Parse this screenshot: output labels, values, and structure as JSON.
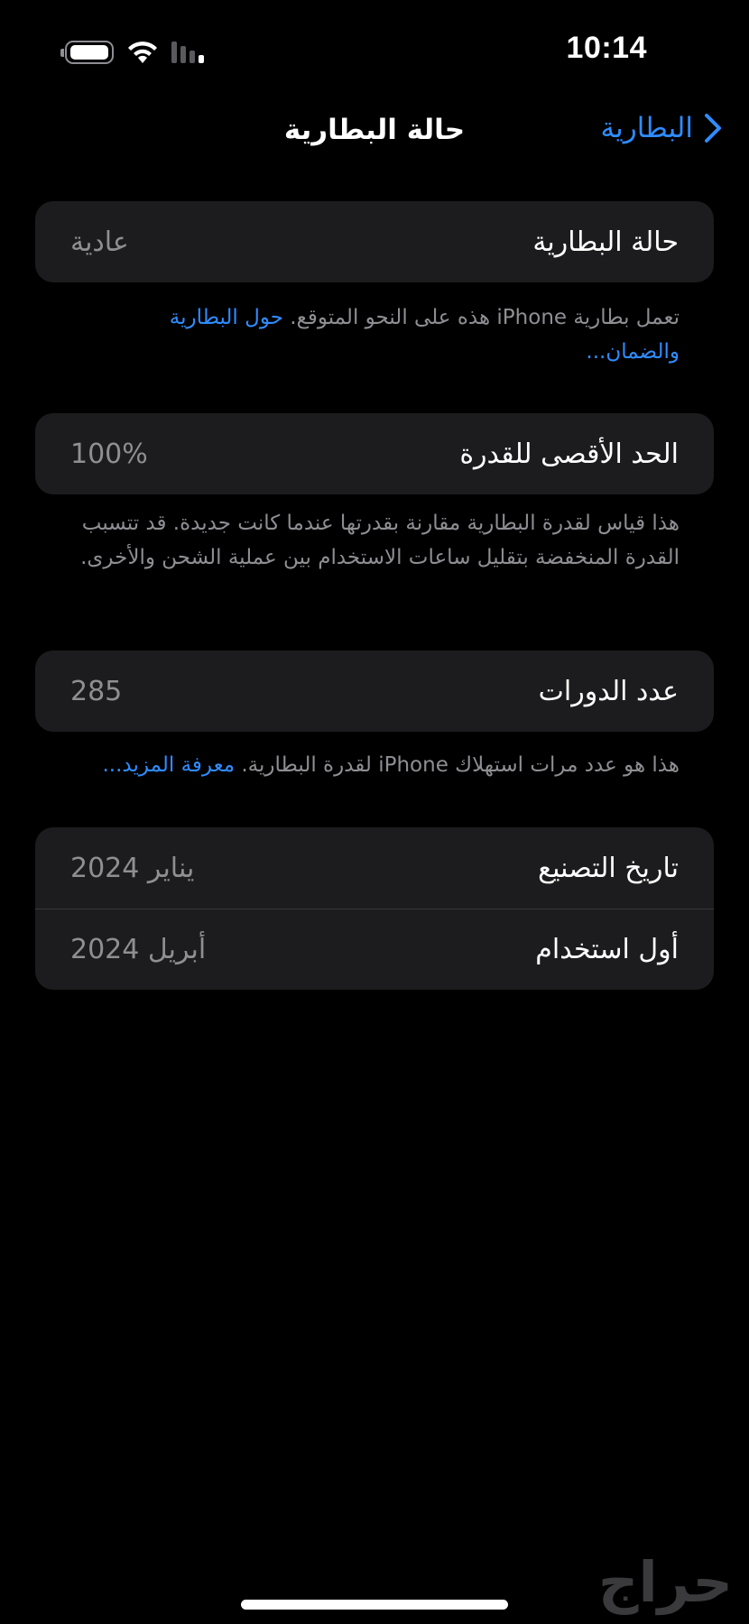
{
  "status_bar": {
    "time": "10:14",
    "battery_icon": "battery-icon",
    "wifi_icon": "wifi-icon",
    "signal_icon": "cellular-signal-icon"
  },
  "nav": {
    "back_label": "البطارية",
    "back_icon": "chevron-right-icon",
    "title": "حالة البطارية"
  },
  "battery_condition": {
    "label": "حالة البطارية",
    "value": "عادية",
    "note_text": "تعمل بطارية iPhone هذه على النحو المتوقع.",
    "note_link": "حول البطارية والضمان..."
  },
  "maximum_capacity": {
    "label": "الحد الأقصى للقدرة",
    "value": "100%",
    "note_text": "هذا قياس لقدرة البطارية مقارنة بقدرتها عندما كانت جديدة. قد تتسبب القدرة المنخفضة بتقليل ساعات الاستخدام بين عملية الشحن والأخرى."
  },
  "cycle_count": {
    "label": "عدد الدورات",
    "value": "285",
    "note_text": "هذا هو عدد مرات استهلاك iPhone لقدرة البطارية.",
    "note_link": "معرفة المزيد..."
  },
  "dates": {
    "manufacture_label": "تاريخ التصنيع",
    "manufacture_value": "يناير 2024",
    "first_use_label": "أول استخدام",
    "first_use_value": "أبريل 2024"
  },
  "watermark": "حراج",
  "colors": {
    "background": "#000000",
    "group_background": "#1c1c1e",
    "accent": "#2f8cff",
    "secondary_text": "#8e8e93"
  }
}
